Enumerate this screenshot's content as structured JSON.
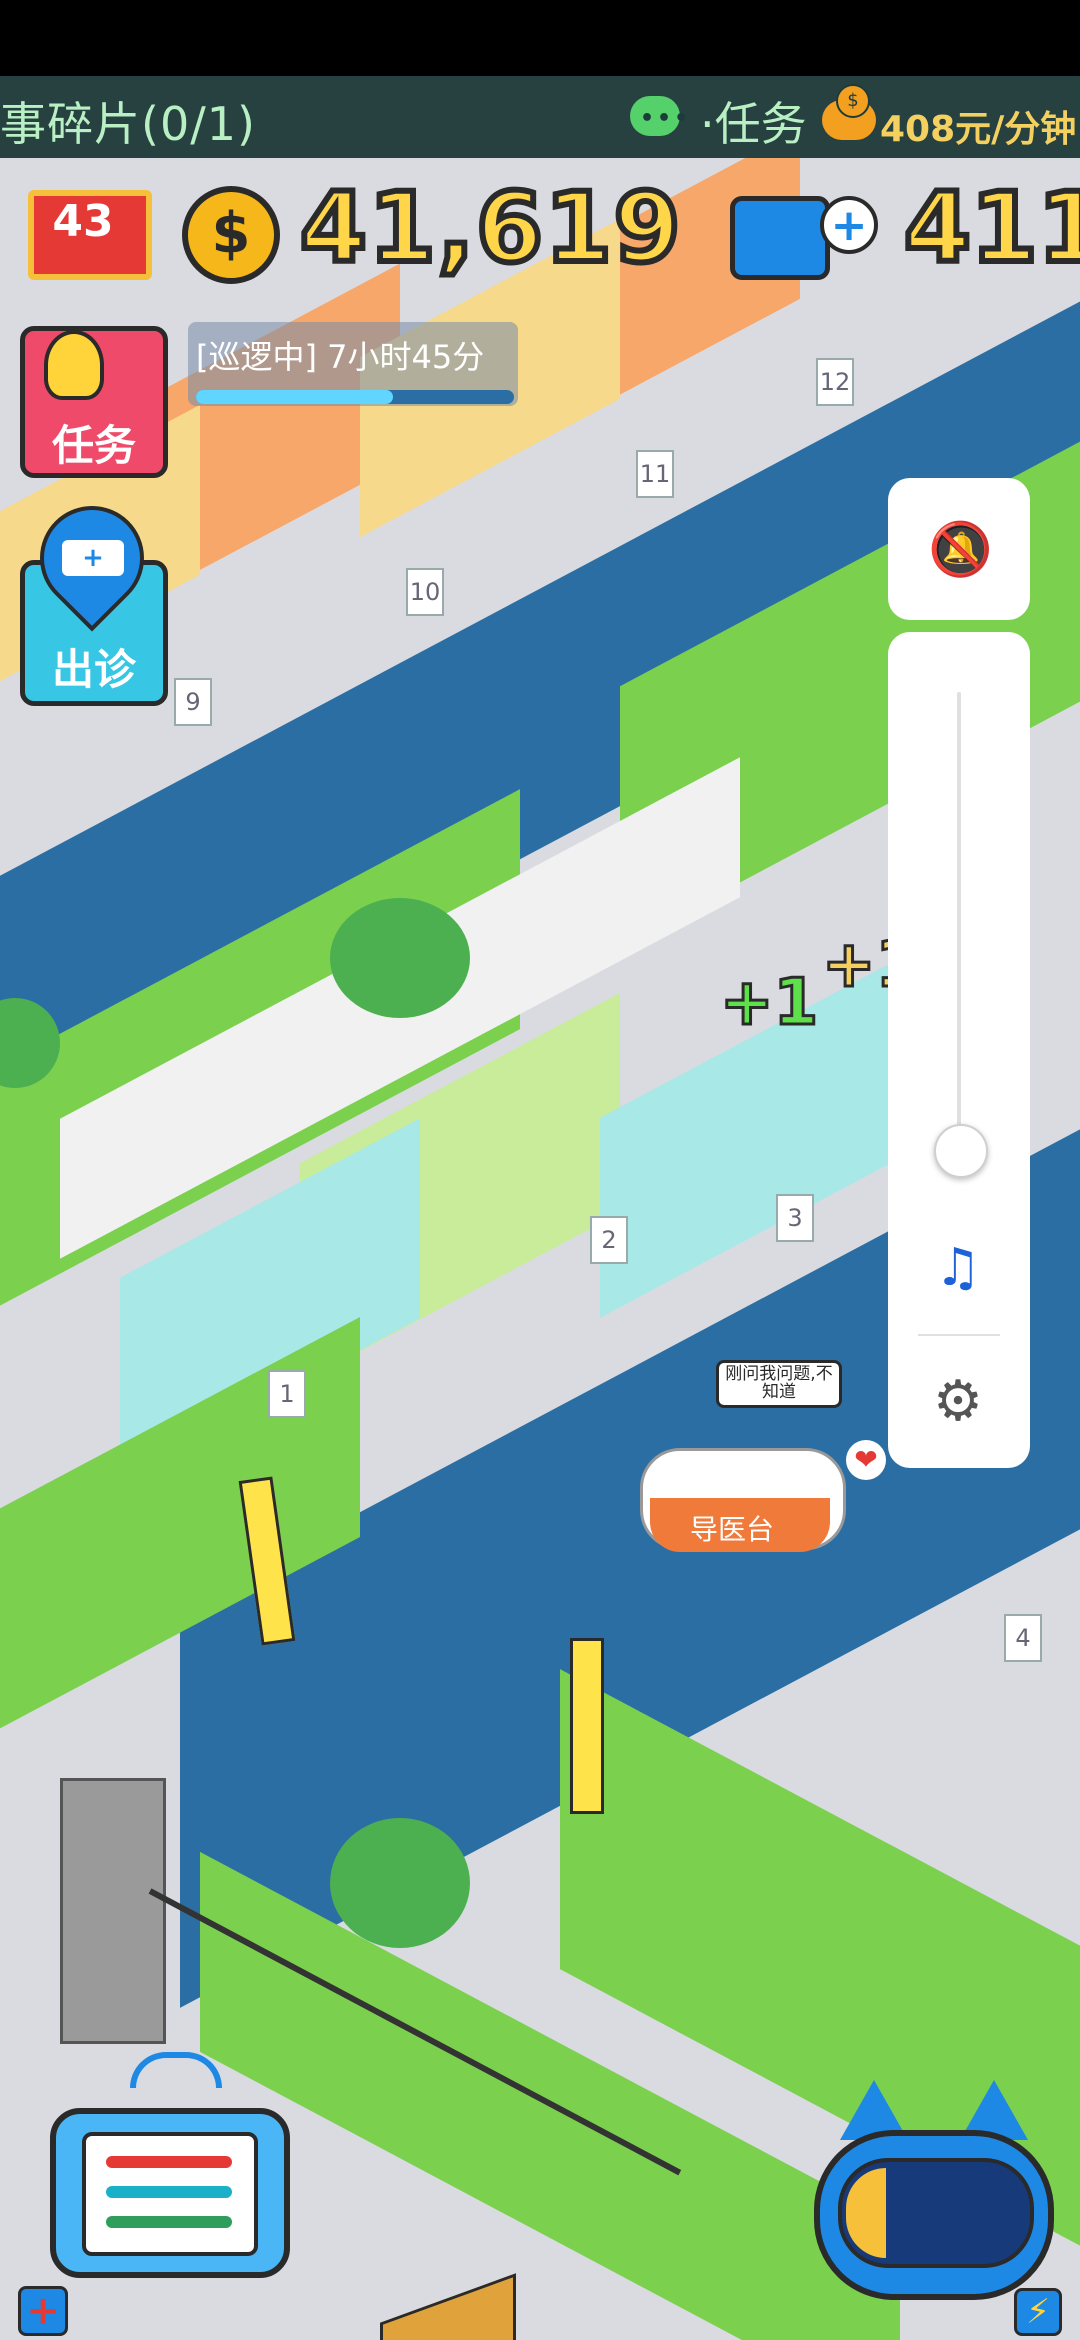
{
  "ticker": {
    "left_text": "事碎片(0/1)",
    "chat_dots": "•••",
    "task_text": "·任务",
    "rate_text": "408元/分钟",
    "piggy_coin": "$"
  },
  "hud": {
    "level": "43",
    "coin_symbol": "$",
    "coins": "41,619",
    "gems": "411",
    "plus_symbol": "+"
  },
  "patrol": {
    "text": "[巡逻中] 7小时45分",
    "progress": 0.62
  },
  "buttons": {
    "task_label": "任务",
    "visit_label": "出诊",
    "ambulance_glyph": "+",
    "plus_glyph": "+",
    "lightning_glyph": "⚡"
  },
  "volume": {
    "bell_glyph": "🔕",
    "music_glyph": "♫",
    "settings_glyph": "⚙",
    "level": 0.05
  },
  "world": {
    "speech_bubble": "刚问我问题,不知道",
    "desk_label": "导医台",
    "heart_glyph": "❤",
    "plus_one": "+1",
    "plus_one_b": "+1",
    "room_numbers": [
      "12",
      "11",
      "10",
      "9",
      "3",
      "2",
      "1",
      "4"
    ]
  },
  "colors": {
    "accent_blue": "#1e88e5",
    "task_red": "#f04a6a",
    "gold": "#ffd64a",
    "floor_blue": "#2b6ea3",
    "grass": "#7bd04e"
  }
}
